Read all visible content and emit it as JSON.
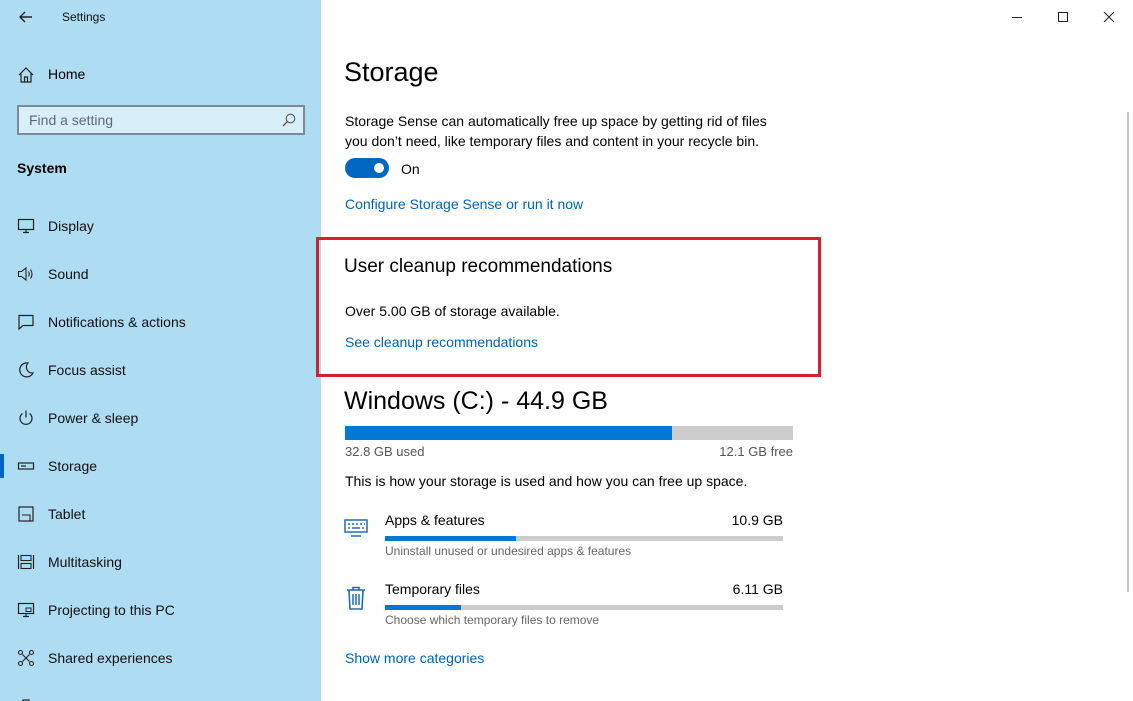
{
  "window": {
    "title": "Settings",
    "controls": [
      "minimize-icon",
      "maximize-icon",
      "close-icon"
    ]
  },
  "sidebar": {
    "home_label": "Home",
    "search": {
      "placeholder": "Find a setting"
    },
    "section_label": "System",
    "items": [
      {
        "label": "Display",
        "icon": "display-icon",
        "active": false
      },
      {
        "label": "Sound",
        "icon": "sound-icon",
        "active": false
      },
      {
        "label": "Notifications & actions",
        "icon": "notifications-icon",
        "active": false
      },
      {
        "label": "Focus assist",
        "icon": "focus-assist-icon",
        "active": false
      },
      {
        "label": "Power & sleep",
        "icon": "power-icon",
        "active": false
      },
      {
        "label": "Storage",
        "icon": "storage-icon",
        "active": true
      },
      {
        "label": "Tablet",
        "icon": "tablet-icon",
        "active": false
      },
      {
        "label": "Multitasking",
        "icon": "multitasking-icon",
        "active": false
      },
      {
        "label": "Projecting to this PC",
        "icon": "projecting-icon",
        "active": false
      },
      {
        "label": "Shared experiences",
        "icon": "shared-experiences-icon",
        "active": false
      }
    ]
  },
  "main": {
    "title": "Storage",
    "description": "Storage Sense can automatically free up space by getting rid of files you don’t need, like temporary files and content in your recycle bin.",
    "storage_sense": {
      "state": "On",
      "enabled": true
    },
    "configure_link": "Configure Storage Sense or run it now",
    "cleanup": {
      "heading": "User cleanup recommendations",
      "text": "Over 5.00 GB of storage available.",
      "link": "See cleanup recommendations"
    },
    "drive": {
      "title": "Windows (C:) - 44.9 GB",
      "used_label": "32.8 GB used",
      "free_label": "12.1 GB free",
      "used_fraction": 0.73
    },
    "usage_text": "This is how your storage is used and how you can free up space.",
    "categories": [
      {
        "name": "Apps & features",
        "size": "10.9 GB",
        "description": "Uninstall unused or undesired apps & features",
        "fraction": 0.33,
        "icon": "apps-features-icon"
      },
      {
        "name": "Temporary files",
        "size": "6.11 GB",
        "description": "Choose which temporary files to remove",
        "fraction": 0.19,
        "icon": "trash-icon"
      }
    ],
    "more_link": "Show more categories"
  },
  "colors": {
    "sidebar_bg": "#aedcf2",
    "accent": "#0078d4",
    "link": "#0063b1",
    "highlight": "#d3212d"
  }
}
